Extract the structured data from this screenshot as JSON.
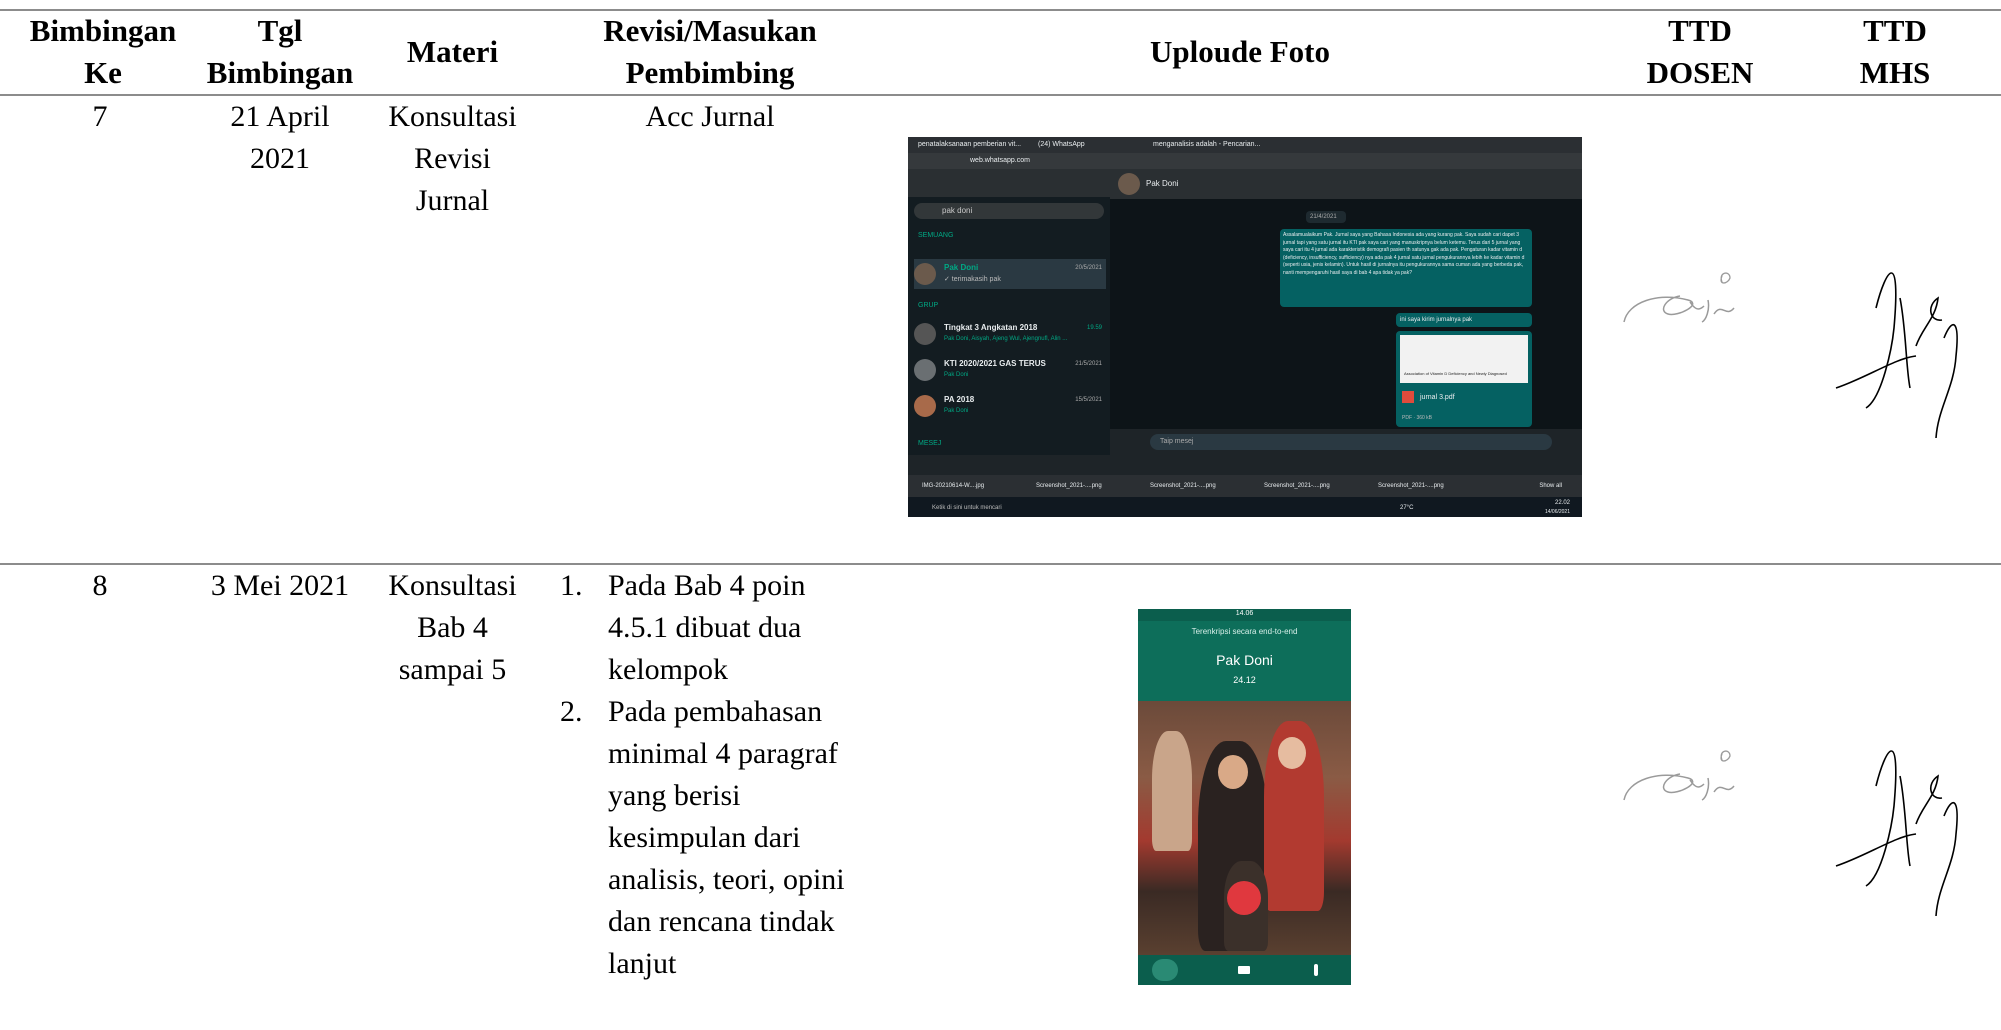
{
  "table": {
    "headers": {
      "bimbingan_ke": [
        "Bimbingan",
        "Ke"
      ],
      "tgl": [
        "Tgl",
        "Bimbingan"
      ],
      "materi": "Materi",
      "revisi": [
        "Revisi/Masukan",
        "Pembimbing"
      ],
      "foto": "Uploude Foto",
      "ttd_dosen": [
        "TTD",
        "DOSEN"
      ],
      "ttd_mhs": [
        "TTD",
        "MHS"
      ]
    },
    "rows": [
      {
        "no": "7",
        "tgl": [
          "21 April",
          "2021"
        ],
        "materi": [
          "Konsultasi",
          "Revisi",
          "Jurnal"
        ],
        "revisi_text": "Acc Jurnal",
        "revisi_list": [],
        "photo": {
          "type": "whatsapp-web",
          "tab1": "penatalaksanaan pemberian vit...",
          "tab2": "(24) WhatsApp",
          "tab3": "menganalisis adalah - Pencarian...",
          "url": "web.whatsapp.com",
          "search": "pak doni",
          "section_chats": "SEMUANG",
          "contact": "Pak Doni",
          "contact_date": "20/5/2021",
          "contact_last": "✓ terimakasih pak",
          "section_group": "GRUP",
          "group1": "Tingkat 3 Angkatan 2018",
          "group1_sub": "Pak Doni, Aisyah, Ajeng Wul, Ajengnufl, Alin ...",
          "group1_time": "19.59",
          "group2": "KTI 2020/2021 GAS TERUS",
          "group2_sub": "Pak Doni",
          "group2_date": "21/5/2021",
          "group3": "PA 2018",
          "group3_sub": "Pak Doni",
          "group3_date": "15/5/2021",
          "section_msg": "MESEJ",
          "header_name": "Pak Doni",
          "date_chip": "21/4/2021",
          "message": "Assalamualaikum Pak. Jurnal saya yang Bahasa Indonesia ada yang kurang pak. Saya sudah cari dapet 3 jurnal tapi yang satu jurnal itu KTI pak saya cari yang manuskripnya belum ketemu. Terus dari 5 jurnal yang saya cari itu 4 jurnal ada karakteristik demografi pasien th satunya gak ada pak. Pengaturan kadar vitamin d (deficiency, insufficiency, sufficiency) nya ada pak 4 jurnal satu jurnal pengukurannya lebih ke kadar vitamin d (seperti usia, jenis kelamin). Untuk hasil di jurnalnya itu pengukurannya sama cuman ada yang berbeda pak, nanti mempengaruhi hasil saya di bab 4 apa tidak ya pak?",
          "message_time": "11.18",
          "reply": "ini saya kirim jurnalnya pak",
          "reply_time": "11.18",
          "pdf_title": "Association of Vitamin D Deficiency and Newly Diagnosed",
          "pdf_name": "jurnal 3.pdf",
          "pdf_meta": "PDF · 360 kB",
          "pdf_time": "11.19",
          "composer": "Taip mesej",
          "downloads": [
            "IMG-20210614-W....jpg",
            "Screenshot_2021-....png",
            "Screenshot_2021-....png",
            "Screenshot_2021-....png",
            "Screenshot_2021-....png"
          ],
          "show_all": "Show all",
          "taskbar_search": "Ketik di sini untuk mencari",
          "temp": "27°C",
          "clock_time": "22.02",
          "clock_date": "14/06/2021"
        }
      },
      {
        "no": "8",
        "tgl": [
          "3 Mei 2021"
        ],
        "materi": [
          "Konsultasi",
          "Bab 4",
          "sampai 5"
        ],
        "revisi_text": "",
        "revisi_list": [
          {
            "num": "1.",
            "lines": [
              "Pada Bab 4 poin",
              "4.5.1 dibuat dua",
              "kelompok"
            ]
          },
          {
            "num": "2.",
            "lines": [
              "Pada pembahasan",
              "minimal 4 paragraf",
              "yang berisi",
              "kesimpulan dari",
              "analisis, teori, opini",
              "dan rencana tindak",
              "lanjut"
            ]
          }
        ],
        "photo": {
          "type": "whatsapp-call",
          "status_time": "14.06",
          "encrypted": "Terenkripsi secara end-to-end",
          "name": "Pak Doni",
          "duration": "24.12"
        }
      }
    ]
  },
  "colors": {
    "whatsapp_green": "#0d6e5a",
    "bubble": "#056162",
    "end_call": "#e0383e",
    "rule": "#8c8c8c"
  }
}
